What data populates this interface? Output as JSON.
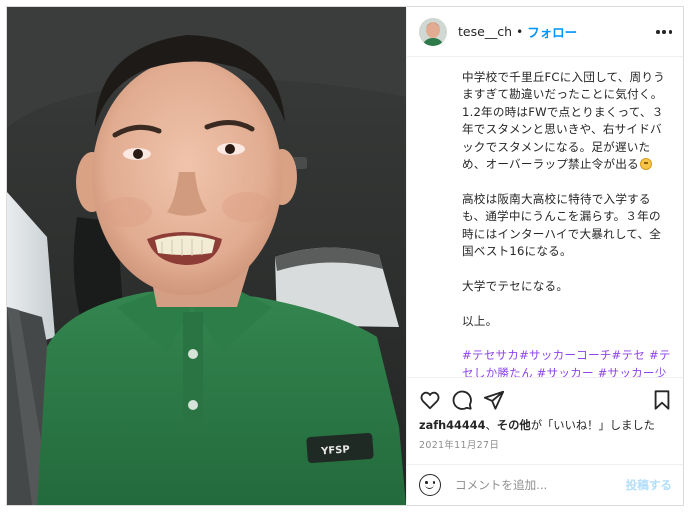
{
  "post": {
    "username": "tese__ch",
    "separator": "•",
    "follow_label": "フォロー",
    "more_icon": "more-horizontal-icon"
  },
  "caption": {
    "paragraph_1": "中学校で千里丘FCに入団して、周りうますぎて勘違いだったことに気付く。1.2年の時はFWで点とりまくって、３年でスタメンと思いきや、右サイドバックでスタメンになる。足が遅いため、オーバーラップ禁止令が出る",
    "paragraph_1_emoji": "upside-down-face-emoji",
    "paragraph_2": "高校は阪南大高校に特待で入学するも、通学中にうんこを漏らす。３年の時にはインターハイで大暴れして、全国ベスト16になる。",
    "paragraph_3": "大学でテセになる。",
    "paragraph_4": "以上。",
    "hashtags": "#テセサカ#サッカーコーチ#テセ #テセしか勝たん #サッカー #サッカー少年 #サッカー部 #サッカー選手#サッカートレーニング #サッカー好きな人と繋がりたい #サッカー小僧 #サッカークラブ #"
  },
  "actions": {
    "like_icon": "heart-icon",
    "comment_icon": "comment-icon",
    "share_icon": "send-icon",
    "save_icon": "bookmark-icon"
  },
  "likes": {
    "user": "zafh44444",
    "connector": "、",
    "others": "その他",
    "suffix": "が「いいね！」しました"
  },
  "date": "2021年11月27日",
  "comment": {
    "placeholder": "コメントを追加...",
    "post_label": "投稿する"
  },
  "photo": {
    "shirt_logo": "YFSP",
    "colors": {
      "shirt": "#2f7a4a",
      "car_interior": "#2a2c2b",
      "skin": "#e8b9a0"
    }
  },
  "colors": {
    "accent": "#0095f6",
    "hashtag": "#8e44ec",
    "muted": "#8e8e8e",
    "post_disabled": "#b2dffc"
  }
}
